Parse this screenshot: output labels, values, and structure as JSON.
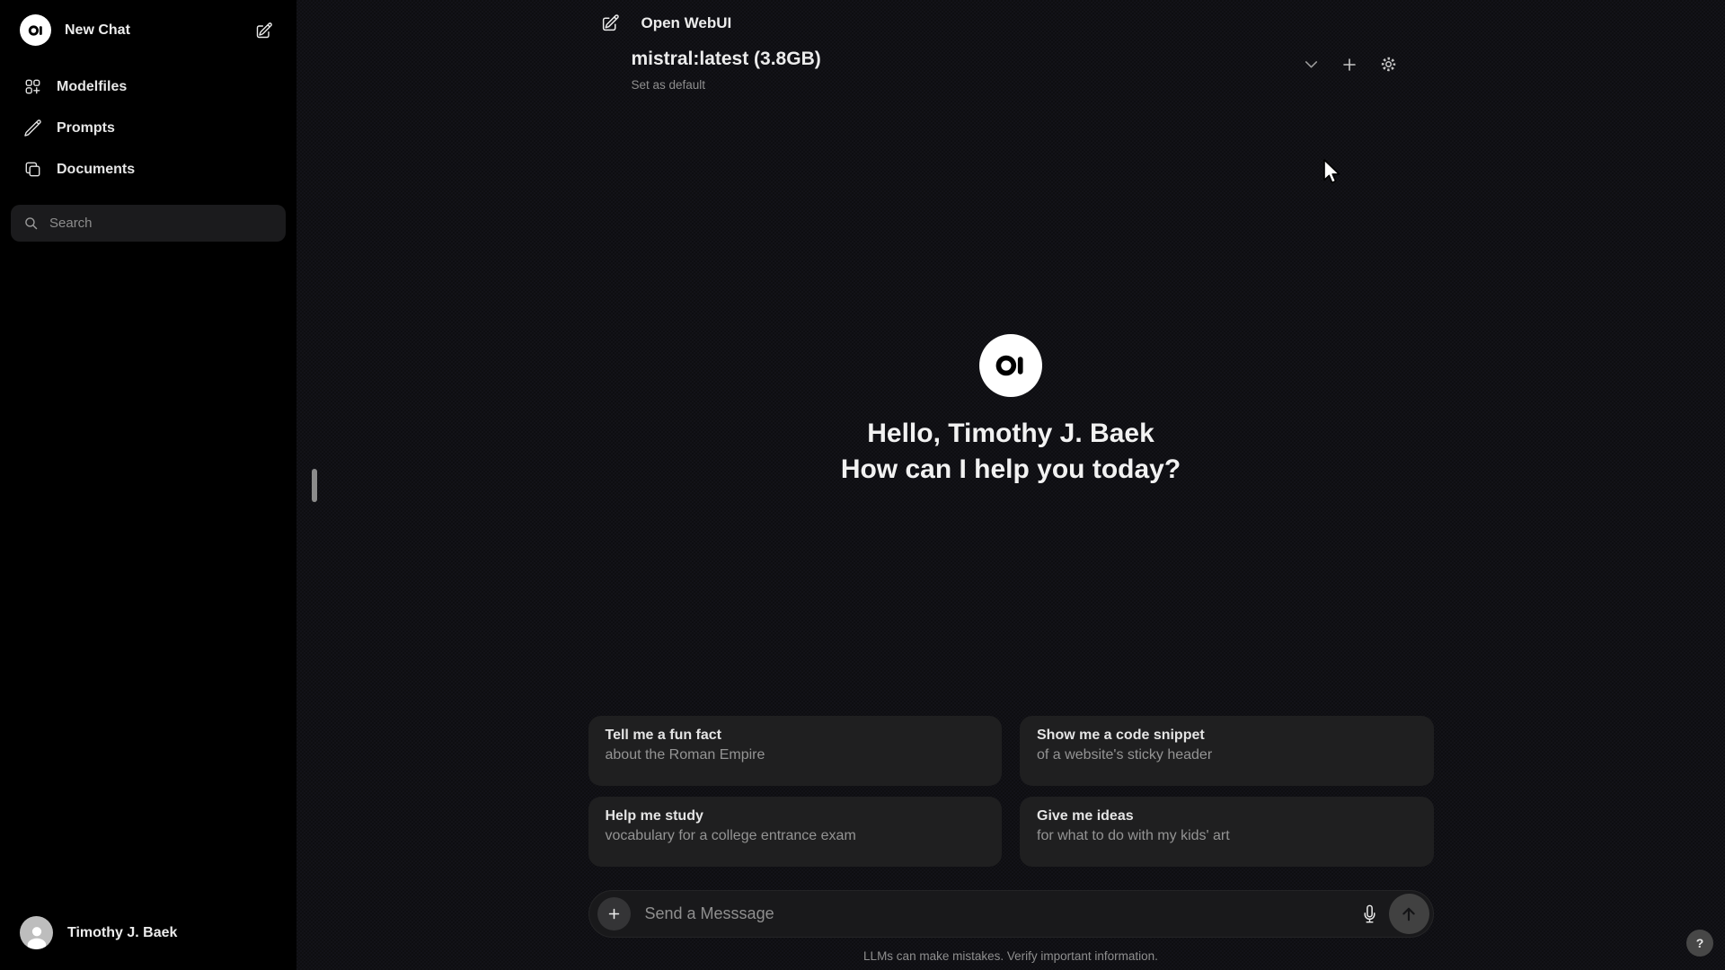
{
  "app": {
    "title": "Open WebUI",
    "help_label": "?"
  },
  "sidebar": {
    "new_chat_label": "New Chat",
    "items": [
      {
        "label": "Modelfiles",
        "icon": "squares-plus-icon"
      },
      {
        "label": "Prompts",
        "icon": "pencil-icon"
      },
      {
        "label": "Documents",
        "icon": "document-duplicate-icon"
      }
    ],
    "search": {
      "placeholder": "Search"
    },
    "user": {
      "name": "Timothy J. Baek"
    }
  },
  "model_bar": {
    "model_name": "mistral:latest (3.8GB)",
    "set_default_label": "Set as default",
    "icons": [
      "chevron-down-icon",
      "plus-icon",
      "gear-icon"
    ]
  },
  "greeting": {
    "line1": "Hello, Timothy J. Baek",
    "line2": "How can I help you today?"
  },
  "suggestions": [
    {
      "title": "Tell me a fun fact",
      "subtitle": "about the Roman Empire"
    },
    {
      "title": "Show me a code snippet",
      "subtitle": "of a website's sticky header"
    },
    {
      "title": "Help me study",
      "subtitle": "vocabulary for a college entrance exam"
    },
    {
      "title": "Give me ideas",
      "subtitle": "for what to do with my kids' art"
    }
  ],
  "composer": {
    "placeholder": "Send a Messsage"
  },
  "footer": {
    "disclaimer": "LLMs can make mistakes. Verify important information."
  },
  "colors": {
    "sidebar_bg": "#000000",
    "main_bg": "#0e0e11",
    "card_bg": "#1f1f20",
    "text_primary": "#ececec",
    "text_secondary": "#8f8f8f"
  }
}
